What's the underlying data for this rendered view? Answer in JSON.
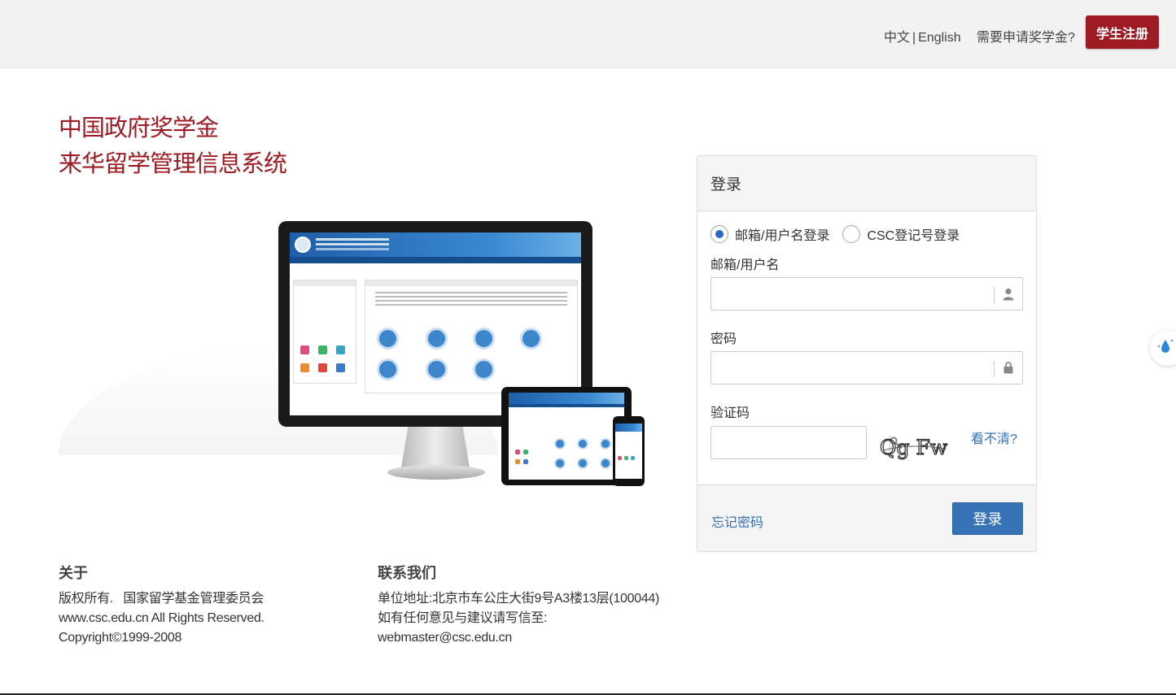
{
  "header": {
    "lang_zh": "中文",
    "lang_sep": "|",
    "lang_en": "English",
    "apply_link": "需要申请奖学金?",
    "register_button": "学生注册",
    "brand_color": "#9e1b23"
  },
  "hero": {
    "title_line1": "中国政府奖学金",
    "title_line2": "来华留学管理信息系统"
  },
  "login": {
    "title": "登录",
    "radio_options": [
      "邮箱/用户名登录",
      "CSC登记号登录"
    ],
    "selected_option": "邮箱/用户名登录",
    "username_label": "邮箱/用户名",
    "username_value": "",
    "password_label": "密码",
    "password_value": "",
    "captcha_label": "验证码",
    "captcha_value": "",
    "captcha_text": "Qg Fw",
    "refresh_link": "看不清?",
    "forgot_link": "忘记密码",
    "login_button": "登录",
    "accent_color": "#3771b6"
  },
  "footer": {
    "about": {
      "heading": "关于",
      "line1": "版权所有.   国家留学基金管理委员会",
      "line2": "www.csc.edu.cn All Rights Reserved.",
      "line3": "Copyright©1999-2008"
    },
    "contact": {
      "heading": "联系我们",
      "line1": "单位地址:北京市车公庄大街9号A3楼13层(100044)",
      "line2": "如有任何意见与建议请写信至:",
      "line3": "webmaster@csc.edu.cn"
    }
  },
  "icons": {
    "username_addon": "user-icon",
    "password_addon": "lock-icon",
    "captcha_addon": "key-icon",
    "side_widget": "water-drop-icon"
  }
}
